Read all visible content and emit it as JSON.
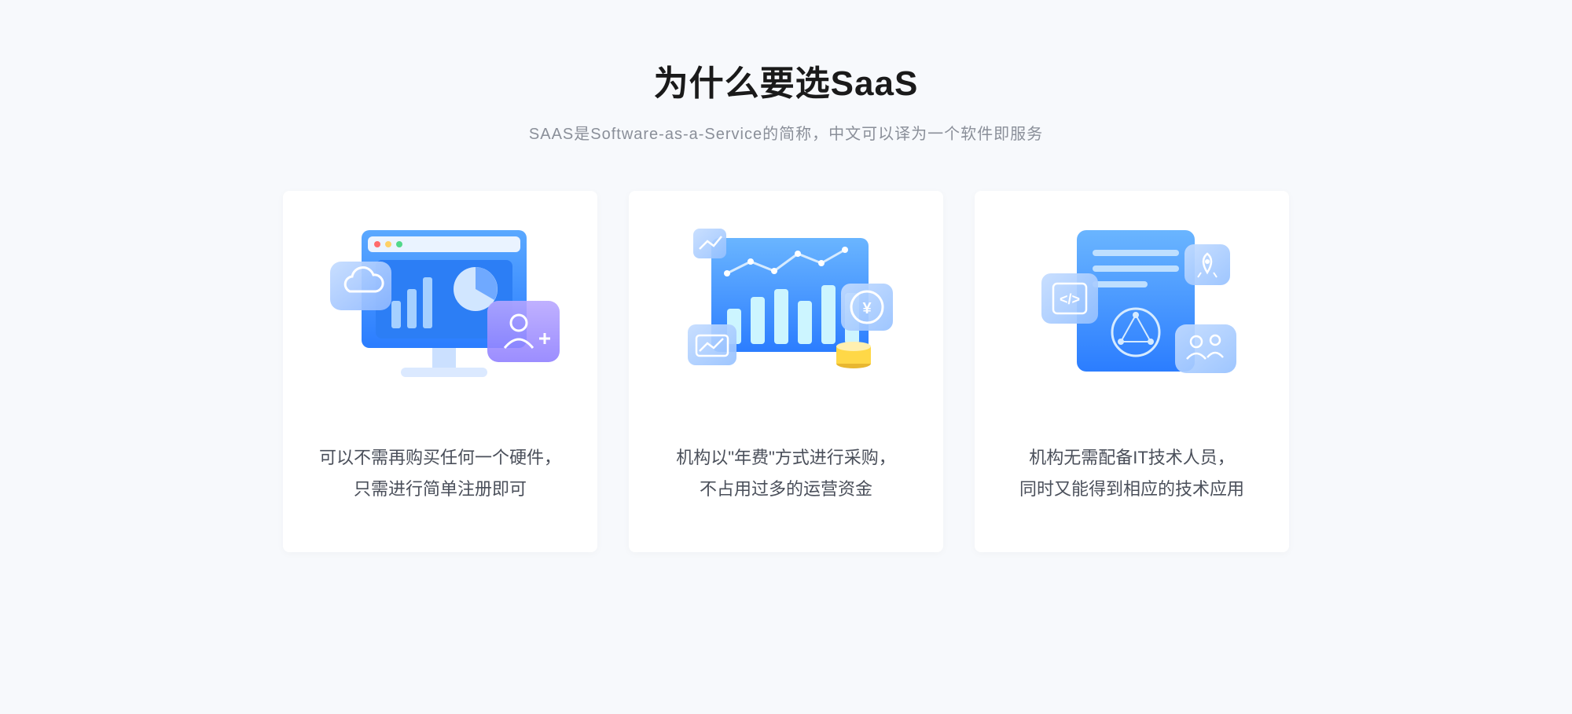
{
  "header": {
    "title": "为什么要选SaaS",
    "subtitle": "SAAS是Software-as-a-Service的简称，中文可以译为一个软件即服务"
  },
  "cards": [
    {
      "line1": "可以不需再购买任何一个硬件，",
      "line2": "只需进行简单注册即可"
    },
    {
      "line1": "机构以\"年费\"方式进行采购，",
      "line2": "不占用过多的运营资金"
    },
    {
      "line1": "机构无需配备IT技术人员，",
      "line2": "同时又能得到相应的技术应用"
    }
  ]
}
